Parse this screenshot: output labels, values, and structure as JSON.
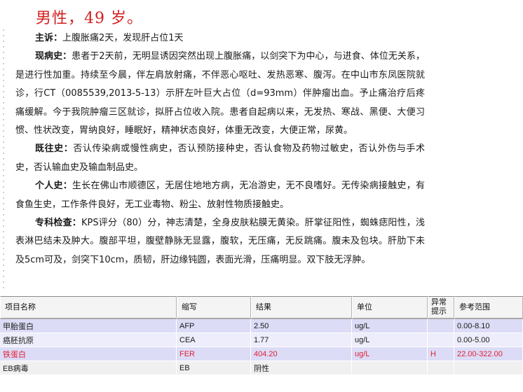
{
  "patient_header": "男性，49 岁。",
  "record": [
    {
      "label": "主诉：",
      "text": "上腹胀痛2天，发现肝占位1天"
    },
    {
      "label": "现病史：",
      "text": "患者于2天前，无明显诱因突然出现上腹胀痛，以剑突下为中心，与进食、体位无关系，是进行性加重。持续至今晨，伴左肩放射痛，不伴恶心呕吐、发热恶寒、腹泻。在中山市东凤医院就诊，行CT（0085539,2013-5-13）示肝左叶巨大占位（d=93mm）伴肿瘤出血。予止痛治疗后疼痛缓解。今于我院肿瘤三区就诊，拟肝占位收入院。患者自起病以来，无发热、寒战、黑便、大便习惯、性状改变，胃纳良好，睡眠好，精神状态良好，体重无改变，大便正常，尿黄。"
    },
    {
      "label": "既往史：",
      "text": "否认传染病或慢性病史，否认预防接种史，否认食物及药物过敏史，否认外伤与手术史，否认输血史及输血制品史。"
    },
    {
      "label": "个人史：",
      "text": "生长在佛山市顺德区，无居住地地方病，无冶游史，无不良嗜好。无传染病接触史，有食鱼生史，工作条件良好，无工业毒物、粉尘、放射性物质接触史。"
    },
    {
      "label": "专科检查：",
      "text": "KPS评分（80）分，神志清楚，全身皮肤粘膜无黄染。肝掌征阳性，蜘蛛痣阳性，浅表淋巴结未及肿大。腹部平坦，腹壁静脉无显露，腹软，无压痛，无反跳痛。腹未及包块。肝肋下未及5cm可及，剑突下10cm，质韧，肝边缘钝圆，表面光滑，压痛明显。双下肢无浮肿。"
    }
  ],
  "lab_table": {
    "headers": {
      "name": "项目名称",
      "abbr": "缩写",
      "result": "结果",
      "unit": "单位",
      "flag": "异常\n提示",
      "ref": "参考范围"
    },
    "rows": [
      {
        "name": "甲胎蛋白",
        "abbr": "AFP",
        "result": "2.50",
        "unit": "ug/L",
        "flag": "",
        "ref": "0.00-8.10",
        "abnormal": false
      },
      {
        "name": "癌胚抗原",
        "abbr": "CEA",
        "result": "1.77",
        "unit": "ug/L",
        "flag": "",
        "ref": "0.00-5.00",
        "abnormal": false
      },
      {
        "name": "铁蛋白",
        "abbr": "FER",
        "result": "404.20",
        "unit": "ug/L",
        "flag": "H",
        "ref": "22.00-322.00",
        "abnormal": true
      },
      {
        "name": "EB病毒",
        "abbr": "EB",
        "result": "阴性",
        "unit": "",
        "flag": "",
        "ref": "",
        "abnormal": false
      }
    ]
  },
  "colors": {
    "header_red": "#d42020",
    "abnormal_red": "#e0203a",
    "row_lavender": "#dcdcf6"
  }
}
